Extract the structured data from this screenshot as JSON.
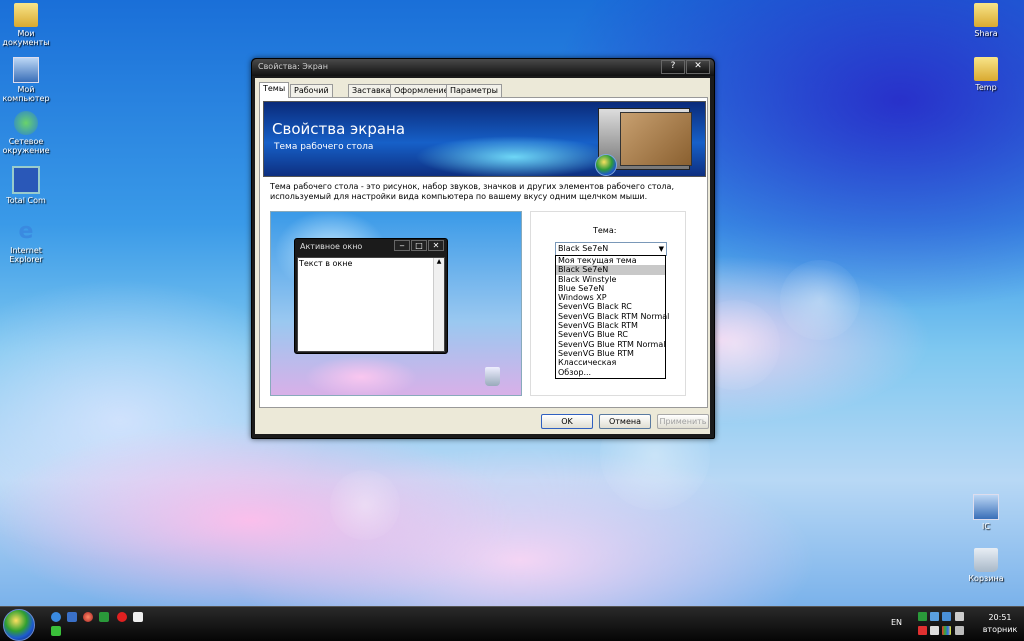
{
  "desktop": {
    "icons_left": [
      {
        "label": "Мои документы",
        "icon": "folder-icon"
      },
      {
        "label": "Мой компьютер",
        "icon": "computer-icon"
      },
      {
        "label": "Сетевое окружение",
        "icon": "network-icon"
      },
      {
        "label": "Total Com",
        "icon": "floppy-icon"
      },
      {
        "label": "Internet Explorer",
        "icon": "ie-icon"
      }
    ],
    "icons_right": [
      {
        "label": "Shara",
        "icon": "folder-icon"
      },
      {
        "label": "Temp",
        "icon": "folder-icon"
      },
      {
        "label": "IC",
        "icon": "network-computer-icon"
      },
      {
        "label": "Корзина",
        "icon": "recycle-bin-icon"
      }
    ]
  },
  "window": {
    "title": "Свойства: Экран",
    "help_glyph": "?",
    "close_glyph": "✕",
    "tabs": [
      "Темы",
      "Рабочий стол",
      "Заставка",
      "Оформление",
      "Параметры"
    ],
    "active_tab": "Темы",
    "banner": {
      "title": "Свойства экрана",
      "subtitle": "Тема рабочего стола"
    },
    "description": "Тема рабочего стола - это рисунок, набор звуков, значков и других элементов рабочего стола, используемый для настройки вида компьютера по вашему вкусу одним щелчком мыши.",
    "preview": {
      "window_title": "Активное окно",
      "window_text": "Текст в окне"
    },
    "theme_label": "Тема:",
    "theme_selected": "Black Se7eN",
    "theme_options": [
      "Моя текущая тема",
      "Black Se7eN",
      "Black Winstyle",
      "Blue Se7eN",
      "Windows XP",
      "SevenVG Black RC",
      "SevenVG Black RTM Normal",
      "SevenVG Black RTM",
      "SevenVG Blue RC",
      "SevenVG Blue RTM Normal",
      "SevenVG Blue RTM",
      "Классическая",
      "Обзор..."
    ],
    "buttons": {
      "ok": "OK",
      "cancel": "Отмена",
      "apply": "Применить"
    }
  },
  "taskbar": {
    "language": "EN",
    "time": "20:51",
    "day": "вторник"
  }
}
